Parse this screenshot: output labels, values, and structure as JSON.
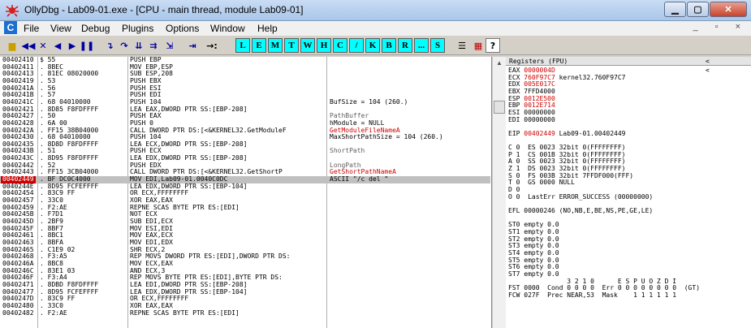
{
  "window": {
    "title": "OllyDbg - Lab09-01.exe - [CPU - main thread, module Lab09-01]"
  },
  "menu": {
    "items": [
      "File",
      "View",
      "Debug",
      "Plugins",
      "Options",
      "Window",
      "Help"
    ],
    "mdi": "_ ▫ ×"
  },
  "toolbar": {
    "buttons": [
      "open",
      "rewind",
      "close",
      "run",
      "pause",
      "step-into",
      "step-over",
      "trace-into",
      "trace-over",
      "execute-till-return",
      "go-to"
    ],
    "letters": [
      "L",
      "E",
      "M",
      "T",
      "W",
      "H",
      "C",
      "/",
      "K",
      "B",
      "R",
      "...",
      "S"
    ]
  },
  "cpu": {
    "rows": [
      {
        "addr": "00402410",
        "hex": "$ 55",
        "dis": "PUSH EBP",
        "cmt": ""
      },
      {
        "addr": "00402411",
        "hex": ". 8BEC",
        "dis": "MOV EBP,ESP",
        "cmt": ""
      },
      {
        "addr": "00402413",
        "hex": ". 81EC 08020000",
        "dis": "SUB ESP,208",
        "cmt": ""
      },
      {
        "addr": "00402419",
        "hex": ". 53",
        "dis": "PUSH EBX",
        "cmt": ""
      },
      {
        "addr": "0040241A",
        "hex": ". 56",
        "dis": "PUSH ESI",
        "cmt": ""
      },
      {
        "addr": "0040241B",
        "hex": ". 57",
        "dis": "PUSH EDI",
        "cmt": ""
      },
      {
        "addr": "0040241C",
        "hex": ". 68 04010000",
        "dis": "PUSH 104",
        "cmt": "BufSize = 104 (260.)"
      },
      {
        "addr": "00402421",
        "hex": ". 8D85 F8FDFFFF",
        "dis": "LEA EAX,DWORD PTR SS:[EBP-208]",
        "cmt": ""
      },
      {
        "addr": "00402427",
        "hex": ". 50",
        "dis": "PUSH EAX",
        "cmt": "PathBuffer"
      },
      {
        "addr": "00402428",
        "hex": ". 6A 00",
        "dis": "PUSH 0",
        "cmt": "hModule = NULL"
      },
      {
        "addr": "0040242A",
        "hex": ". FF15 38B04000",
        "dis": "CALL DWORD PTR DS:[<&KERNEL32.GetModuleF",
        "cmt": "GetModuleFileNameA"
      },
      {
        "addr": "00402430",
        "hex": ". 68 04010000",
        "dis": "PUSH 104",
        "cmt": "MaxShortPathSize = 104 (260.)"
      },
      {
        "addr": "00402435",
        "hex": ". 8D8D F8FDFFFF",
        "dis": "LEA ECX,DWORD PTR SS:[EBP-208]",
        "cmt": ""
      },
      {
        "addr": "0040243B",
        "hex": ". 51",
        "dis": "PUSH ECX",
        "cmt": "ShortPath"
      },
      {
        "addr": "0040243C",
        "hex": ". 8D95 F8FDFFFF",
        "dis": "LEA EDX,DWORD PTR SS:[EBP-208]",
        "cmt": ""
      },
      {
        "addr": "00402442",
        "hex": ". 52",
        "dis": "PUSH EDX",
        "cmt": "LongPath"
      },
      {
        "addr": "00402443",
        "hex": ". FF15 3CB04000",
        "dis": "CALL DWORD PTR DS:[<&KERNEL32.GetShortP",
        "cmt": "GetShortPathNameA"
      },
      {
        "addr": "00402449",
        "hex": ". BF DC0C4000",
        "dis": "MOV EDI,Lab09-01.0040C0DC",
        "cmt": "ASCII \"/c del \"",
        "sel": true
      },
      {
        "addr": "0040244E",
        "hex": ". 8D95 FCFEFFFF",
        "dis": "LEA EDX,DWORD PTR SS:[EBP-104]",
        "cmt": ""
      },
      {
        "addr": "00402454",
        "hex": ". 83C9 FF",
        "dis": "OR ECX,FFFFFFFF",
        "cmt": ""
      },
      {
        "addr": "00402457",
        "hex": ". 33C0",
        "dis": "XOR EAX,EAX",
        "cmt": ""
      },
      {
        "addr": "00402459",
        "hex": ". F2:AE",
        "dis": "REPNE SCAS BYTE PTR ES:[EDI]",
        "cmt": ""
      },
      {
        "addr": "0040245B",
        "hex": ". F7D1",
        "dis": "NOT ECX",
        "cmt": ""
      },
      {
        "addr": "0040245D",
        "hex": ". 2BF9",
        "dis": "SUB EDI,ECX",
        "cmt": ""
      },
      {
        "addr": "0040245F",
        "hex": ". 8BF7",
        "dis": "MOV ESI,EDI",
        "cmt": ""
      },
      {
        "addr": "00402461",
        "hex": ". 8BC1",
        "dis": "MOV EAX,ECX",
        "cmt": ""
      },
      {
        "addr": "00402463",
        "hex": ". 8BFA",
        "dis": "MOV EDI,EDX",
        "cmt": ""
      },
      {
        "addr": "00402465",
        "hex": ". C1E9 02",
        "dis": "SHR ECX,2",
        "cmt": ""
      },
      {
        "addr": "00402468",
        "hex": ". F3:A5",
        "dis": "REP MOVS DWORD PTR ES:[EDI],DWORD PTR DS:",
        "cmt": ""
      },
      {
        "addr": "0040246A",
        "hex": ". 8BC8",
        "dis": "MOV ECX,EAX",
        "cmt": ""
      },
      {
        "addr": "0040246C",
        "hex": ". 83E1 03",
        "dis": "AND ECX,3",
        "cmt": ""
      },
      {
        "addr": "0040246F",
        "hex": ". F3:A4",
        "dis": "REP MOVS BYTE PTR ES:[EDI],BYTE PTR DS:",
        "cmt": ""
      },
      {
        "addr": "00402471",
        "hex": ". 8DBD F8FDFFFF",
        "dis": "LEA EDI,DWORD PTR SS:[EBP-208]",
        "cmt": ""
      },
      {
        "addr": "00402477",
        "hex": ". 8D95 FCFEFFFF",
        "dis": "LEA EDX,DWORD PTR SS:[EBP-104]",
        "cmt": ""
      },
      {
        "addr": "0040247D",
        "hex": ". 83C9 FF",
        "dis": "OR ECX,FFFFFFFF",
        "cmt": ""
      },
      {
        "addr": "00402480",
        "hex": ". 33C0",
        "dis": "XOR EAX,EAX",
        "cmt": ""
      },
      {
        "addr": "00402482",
        "hex": ". F2:AE",
        "dis": "REPNE SCAS BYTE PTR ES:[EDI]",
        "cmt": ""
      }
    ]
  },
  "registers": {
    "header": "Registers (FPU)",
    "arrows": "< <",
    "lines": [
      {
        "t": "EAX ",
        "v": "0000004D",
        "r": true,
        "x": ""
      },
      {
        "t": "ECX ",
        "v": "760F97C7",
        "r": true,
        "x": " kernel32.760F97C7"
      },
      {
        "t": "EDX ",
        "v": "005E017C",
        "r": true,
        "x": ""
      },
      {
        "t": "EBX ",
        "v": "7FFD4000",
        "r": false,
        "x": ""
      },
      {
        "t": "ESP ",
        "v": "0012E500",
        "r": true,
        "x": ""
      },
      {
        "t": "EBP ",
        "v": "0012E714",
        "r": true,
        "x": ""
      },
      {
        "t": "ESI ",
        "v": "00000000",
        "r": false,
        "x": ""
      },
      {
        "t": "EDI ",
        "v": "00000000",
        "r": false,
        "x": ""
      },
      {
        "t": "",
        "v": "",
        "r": false,
        "x": ""
      },
      {
        "t": "EIP ",
        "v": "00402449",
        "r": true,
        "x": " Lab09-01.00402449"
      },
      {
        "t": "",
        "v": "",
        "r": false,
        "x": ""
      },
      {
        "t": "C 0  ES 0023 32bit 0(FFFFFFFF)",
        "v": "",
        "r": false,
        "x": ""
      },
      {
        "t": "P 1  CS 001B 32bit 0(FFFFFFFF)",
        "v": "",
        "r": false,
        "x": ""
      },
      {
        "t": "A 0  SS 0023 32bit 0(FFFFFFFF)",
        "v": "",
        "r": false,
        "x": ""
      },
      {
        "t": "Z 1  DS 0023 32bit 0(FFFFFFFF)",
        "v": "",
        "r": false,
        "x": ""
      },
      {
        "t": "S 0  FS 003B 32bit 7FFDF000(FFF)",
        "v": "",
        "r": false,
        "x": ""
      },
      {
        "t": "T 0  GS 0000 NULL",
        "v": "",
        "r": false,
        "x": ""
      },
      {
        "t": "D 0",
        "v": "",
        "r": false,
        "x": ""
      },
      {
        "t": "O 0  LastErr ERROR_SUCCESS (00000000)",
        "v": "",
        "r": false,
        "x": ""
      },
      {
        "t": "",
        "v": "",
        "r": false,
        "x": ""
      },
      {
        "t": "EFL 00000246 (NO,NB,E,BE,NS,PE,GE,LE)",
        "v": "",
        "r": false,
        "x": ""
      },
      {
        "t": "",
        "v": "",
        "r": false,
        "x": ""
      },
      {
        "t": "ST0 empty 0.0",
        "v": "",
        "r": false,
        "x": ""
      },
      {
        "t": "ST1 empty 0.0",
        "v": "",
        "r": false,
        "x": ""
      },
      {
        "t": "ST2 empty 0.0",
        "v": "",
        "r": false,
        "x": ""
      },
      {
        "t": "ST3 empty 0.0",
        "v": "",
        "r": false,
        "x": ""
      },
      {
        "t": "ST4 empty 0.0",
        "v": "",
        "r": false,
        "x": ""
      },
      {
        "t": "ST5 empty 0.0",
        "v": "",
        "r": false,
        "x": ""
      },
      {
        "t": "ST6 empty 0.0",
        "v": "",
        "r": false,
        "x": ""
      },
      {
        "t": "ST7 empty 0.0",
        "v": "",
        "r": false,
        "x": ""
      },
      {
        "t": "               3 2 1 0      E S P U O Z D I",
        "v": "",
        "r": false,
        "x": ""
      },
      {
        "t": "FST 0000  Cond 0 0 0 0  Err 0 0 0 0 0 0 0 0  (GT)",
        "v": "",
        "r": false,
        "x": ""
      },
      {
        "t": "FCW 027F  Prec NEAR,53  Mask    1 1 1 1 1 1",
        "v": "",
        "r": false,
        "x": ""
      }
    ]
  }
}
